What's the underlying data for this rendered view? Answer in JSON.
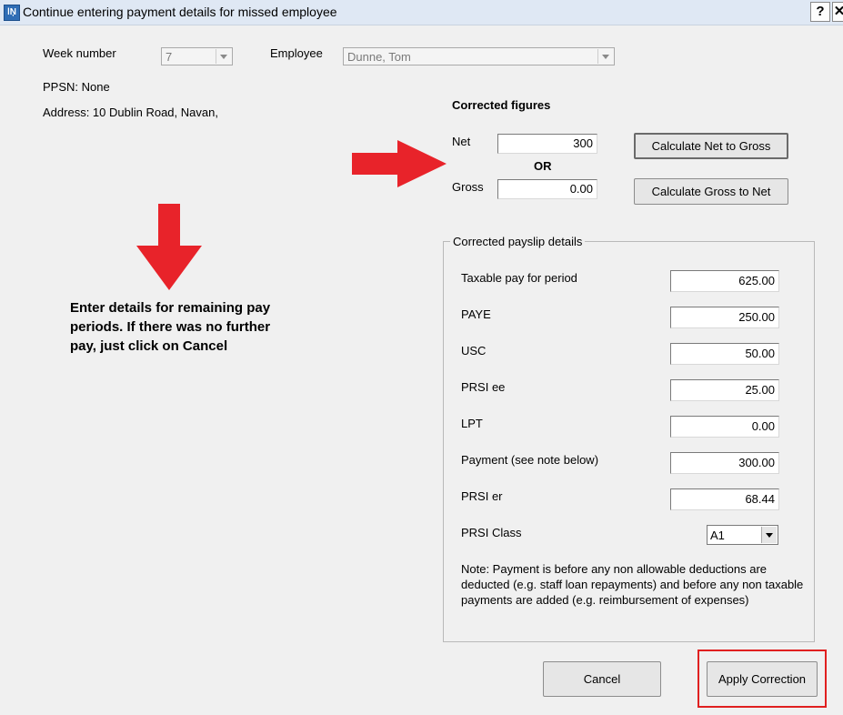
{
  "window": {
    "title": "Continue entering payment details for missed employee",
    "help_label": "?",
    "close_label": "✕"
  },
  "header": {
    "week_number_label": "Week number",
    "week_number_value": "7",
    "employee_label": "Employee",
    "employee_value": "Dunne, Tom",
    "ppsn": "PPSN: None",
    "address": "Address: 10 Dublin Road, Navan,"
  },
  "corrected": {
    "title": "Corrected figures",
    "net_label": "Net",
    "net_value": "300",
    "or_label": "OR",
    "gross_label": "Gross",
    "gross_value": "0.00",
    "net_to_gross_button": "Calculate Net to Gross",
    "gross_to_net_button": "Calculate Gross to Net"
  },
  "payslip": {
    "title": "Corrected payslip details",
    "rows": [
      {
        "label": "Taxable pay for period",
        "value": "625.00"
      },
      {
        "label": "PAYE",
        "value": "250.00"
      },
      {
        "label": "USC",
        "value": "50.00"
      },
      {
        "label": "PRSI ee",
        "value": "25.00"
      },
      {
        "label": "LPT",
        "value": "0.00"
      },
      {
        "label": "Payment (see note below)",
        "value": "300.00"
      },
      {
        "label": "PRSI er",
        "value": "68.44"
      }
    ],
    "prsi_class_label": "PRSI Class",
    "prsi_class_value": "A1",
    "note": "Note: Payment is before any non allowable deductions are deducted (e.g. staff loan repayments) and before any non taxable payments are added (e.g. reimbursement of expenses)"
  },
  "instruction": "Enter details for remaining pay periods. If there was no further pay, just click on Cancel",
  "footer": {
    "cancel_label": "Cancel",
    "apply_label": "Apply Correction"
  },
  "colors": {
    "annotation_red": "#e8232a",
    "titlebar_bg": "#dfe8f4",
    "dialog_bg": "#f0f0f0"
  }
}
